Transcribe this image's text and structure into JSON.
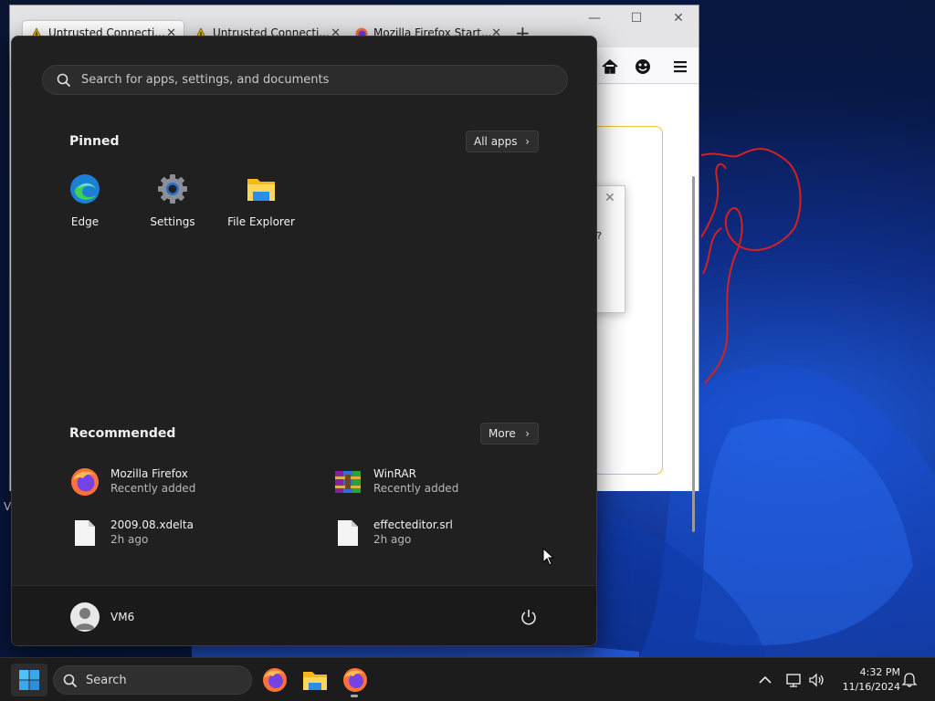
{
  "firefox_window": {
    "tabs": [
      {
        "label": "Untrusted Connecti...",
        "icon": "warning-icon"
      },
      {
        "label": "Untrusted Connecti...",
        "icon": "warning-icon"
      },
      {
        "label": "Mozilla Firefox Start...",
        "icon": "firefox-icon"
      }
    ],
    "dialog_text": "er?",
    "side_letter": "V"
  },
  "start_menu": {
    "search_placeholder": "Search for apps, settings, and documents",
    "pinned_title": "Pinned",
    "all_apps_label": "All apps",
    "pinned": [
      {
        "label": "Edge",
        "icon": "edge-icon"
      },
      {
        "label": "Settings",
        "icon": "settings-gear-icon"
      },
      {
        "label": "File Explorer",
        "icon": "folder-icon"
      }
    ],
    "recommended_title": "Recommended",
    "more_label": "More",
    "recommended": [
      {
        "name": "Mozilla Firefox",
        "sub": "Recently added",
        "icon": "firefox-icon"
      },
      {
        "name": "WinRAR",
        "sub": "Recently added",
        "icon": "winrar-icon"
      },
      {
        "name": "2009.08.xdelta",
        "sub": "2h ago",
        "icon": "file-icon"
      },
      {
        "name": "effecteditor.srl",
        "sub": "2h ago",
        "icon": "file-icon"
      }
    ],
    "user_name": "VM6"
  },
  "taskbar": {
    "search_label": "Search",
    "apps": [
      "firefox-icon",
      "folder-icon",
      "firefox-icon"
    ],
    "time": "4:32 PM",
    "date": "11/16/2024"
  }
}
